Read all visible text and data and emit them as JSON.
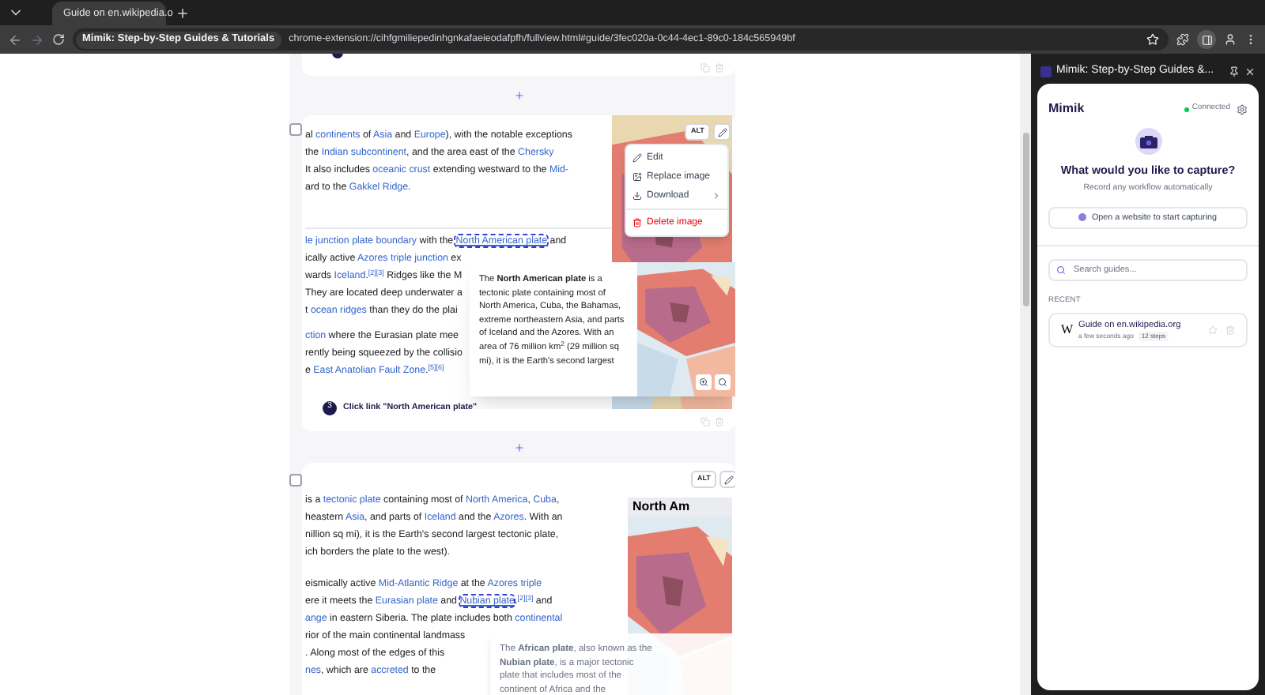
{
  "browser": {
    "tab_title": "Guide on en.wikipedia.o",
    "url_chip": "Mimik: Step-by-Step Guides & Tutorials",
    "url": "chrome-extension://cihfgmiliepedinhgnkafaeieodafpfh/fullview.html#guide/3fec020a-0c44-4ec1-89c0-184c565949bf"
  },
  "step_a": {
    "lines": [
      [
        {
          "kind": "text",
          "t": "al "
        },
        {
          "kind": "link",
          "t": "continents"
        },
        {
          "kind": "text",
          "t": " of "
        },
        {
          "kind": "link",
          "t": "Asia"
        },
        {
          "kind": "text",
          "t": " and "
        },
        {
          "kind": "link",
          "t": "Europe"
        },
        {
          "kind": "text",
          "t": "), with the notable exceptions"
        }
      ],
      [
        {
          "kind": "text",
          "t": "the "
        },
        {
          "kind": "link",
          "t": "Indian subcontinent"
        },
        {
          "kind": "text",
          "t": ", and the area east of the "
        },
        {
          "kind": "link",
          "t": "Chersky"
        }
      ],
      [
        {
          "kind": "text",
          "t": "It also includes "
        },
        {
          "kind": "link",
          "t": "oceanic crust"
        },
        {
          "kind": "text",
          "t": " extending westward to the "
        },
        {
          "kind": "link",
          "t": "Mid-"
        }
      ],
      [
        {
          "kind": "text",
          "t": "ard to the "
        },
        {
          "kind": "link",
          "t": "Gakkel Ridge"
        },
        {
          "kind": "text",
          "t": "."
        }
      ]
    ],
    "lines_2": [
      [
        {
          "kind": "link",
          "t": "le junction plate boundary"
        },
        {
          "kind": "text",
          "t": " with the "
        },
        {
          "kind": "highlight",
          "t": "North American plate"
        },
        {
          "kind": "text",
          "t": " and"
        }
      ],
      [
        {
          "kind": "text",
          "t": "ically active "
        },
        {
          "kind": "link",
          "t": "Azores triple junction"
        },
        {
          "kind": "text",
          "t": " ex"
        }
      ],
      [
        {
          "kind": "text",
          "t": "wards "
        },
        {
          "kind": "link",
          "t": "Iceland"
        },
        {
          "kind": "text",
          "t": ".$^{[2][3]}$ Ridges like the M"
        }
      ],
      [
        {
          "kind": "text",
          "t": "They are located deep underwater a"
        }
      ],
      [
        {
          "kind": "text",
          "t": "t "
        },
        {
          "kind": "link",
          "t": "ocean ridges"
        },
        {
          "kind": "text",
          "t": " than they do the plai"
        }
      ]
    ],
    "lines_3": [
      [
        {
          "kind": "link",
          "t": "ction"
        },
        {
          "kind": "text",
          "t": " where the Eurasian plate mee"
        }
      ],
      [
        {
          "kind": "text",
          "t": "rently being squeezed by the collisio"
        }
      ],
      [
        {
          "kind": "text",
          "t": "e "
        },
        {
          "kind": "link",
          "t": "East Anatolian Fault Zone"
        },
        {
          "kind": "text",
          "t": ".$^{[5][6]}$"
        }
      ]
    ],
    "image_buttons": [
      "ALT"
    ],
    "menu": [
      {
        "kind": "edit",
        "label": "Edit",
        "danger": false
      },
      {
        "kind": "replace",
        "label": "Replace image",
        "danger": false
      },
      {
        "kind": "download",
        "label": "Download",
        "danger": false,
        "submenu": true
      },
      {
        "kind": "delete",
        "label": "Delete image",
        "danger": true
      }
    ],
    "tooltip": "The **North American plate** is a tectonic plate containing most of North America, Cuba, the Bahamas, extreme northeastern Asia, and parts of Iceland and the Azores. With an area of 76 million km$^{2}$ (29 million sq mi), it is the Earth's second largest",
    "step_number": "3",
    "caption": "Click link \"North American plate\"",
    "checked": false
  },
  "step_b": {
    "checked": false,
    "image_buttons": [
      "ALT"
    ],
    "image_title": "North Am",
    "lines": [
      [
        {
          "kind": "text",
          "t": "is a "
        },
        {
          "kind": "link",
          "t": "tectonic plate"
        },
        {
          "kind": "text",
          "t": " containing most of "
        },
        {
          "kind": "link",
          "t": "North America"
        },
        {
          "kind": "text",
          "t": ", "
        },
        {
          "kind": "link",
          "t": "Cuba"
        },
        {
          "kind": "text",
          "t": ","
        }
      ],
      [
        {
          "kind": "text",
          "t": "heastern "
        },
        {
          "kind": "link",
          "t": "Asia"
        },
        {
          "kind": "text",
          "t": ", and parts of "
        },
        {
          "kind": "link",
          "t": "Iceland"
        },
        {
          "kind": "text",
          "t": " and the "
        },
        {
          "kind": "link",
          "t": "Azores"
        },
        {
          "kind": "text",
          "t": ". With an"
        }
      ],
      [
        {
          "kind": "text",
          "t": "nillion sq mi), it is the Earth's second largest tectonic plate,"
        }
      ],
      [
        {
          "kind": "text",
          "t": "ich borders the plate to the west)."
        }
      ]
    ],
    "lines_2": [
      [
        {
          "kind": "text",
          "t": "eismically active "
        },
        {
          "kind": "link",
          "t": "Mid-Atlantic Ridge"
        },
        {
          "kind": "text",
          "t": " at the "
        },
        {
          "kind": "link",
          "t": "Azores triple"
        }
      ],
      [
        {
          "kind": "text",
          "t": "ere it meets the "
        },
        {
          "kind": "link",
          "t": "Eurasian plate"
        },
        {
          "kind": "text",
          "t": " and "
        },
        {
          "kind": "highlight",
          "t": "Nubian plate"
        },
        {
          "kind": "text",
          "t": ".$^{[2][3]}$ and"
        }
      ],
      [
        {
          "kind": "link",
          "t": "ange"
        },
        {
          "kind": "text",
          "t": " in eastern Siberia. The plate includes both "
        },
        {
          "kind": "link",
          "t": "continental"
        }
      ],
      [
        {
          "kind": "text",
          "t": "rior of the main continental landmass"
        }
      ],
      [
        {
          "kind": "text",
          "t": ". Along most of the edges of this"
        }
      ],
      [
        {
          "kind": "link",
          "t": "nes"
        },
        {
          "kind": "text",
          "t": ", which are "
        },
        {
          "kind": "link",
          "t": "accreted"
        },
        {
          "kind": "text",
          "t": " to the"
        }
      ]
    ],
    "tooltip": "The **African plate**, also known as the **Nubian plate**, is a major tectonic plate that includes most of the continent of Africa and the"
  },
  "panel": {
    "header": "Mimik: Step-by-Step Guides &...",
    "logo": "Mimik",
    "status": "Connected",
    "connected": true,
    "heading": "What would you like to capture?",
    "subheading": "Record any workflow automatically",
    "start_button": "Open a website to start capturing",
    "search": {
      "placeholder": "Search guides..."
    },
    "recent_label": "RECENT",
    "recent": [
      {
        "icon_letter": "W",
        "title": "Guide on en.wikipedia.org",
        "time": "a few seconds ago",
        "steps": "12 steps",
        "starred": false
      }
    ]
  }
}
